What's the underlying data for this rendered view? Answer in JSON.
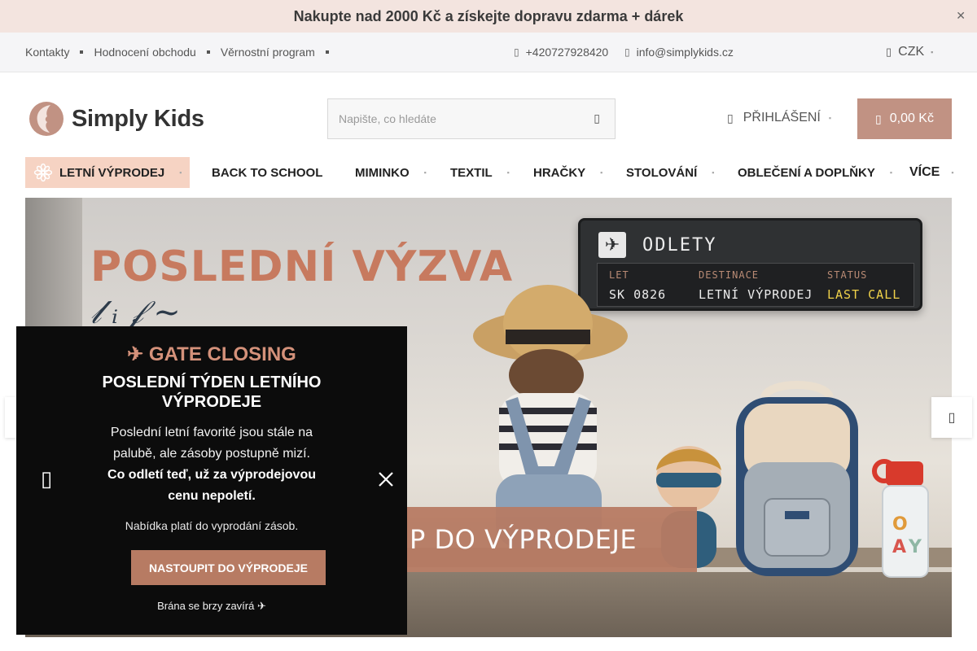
{
  "promo": {
    "text": "Nakupte nad 2000 Kč a získejte  dopravu zdarma +  dárek",
    "close_icon": "close-icon"
  },
  "topbar": {
    "links": [
      "Kontakty",
      "Hodnocení obchodu",
      "Věrnostní program"
    ],
    "phone": "+420727928420",
    "email": "info@simplykids.cz",
    "currency": "CZK"
  },
  "header": {
    "logo_text": "Simply Kids",
    "search_placeholder": "Napište, co hledáte",
    "login_label": "PŘIHLÁŠENÍ",
    "cart_total": "0,00 Kč"
  },
  "nav": {
    "items": [
      "LETNÍ VÝPRODEJ",
      "BACK TO SCHOOL",
      "MIMINKO",
      "TEXTIL",
      "HRAČKY",
      "STOLOVÁNÍ",
      "OBLEČENÍ A DOPLŇKY",
      "VÍCE"
    ]
  },
  "hero": {
    "title": "POSLEDNÍ VÝZVA",
    "board_title": "ODLETY",
    "board_headers": [
      "LET",
      "DESTINACE",
      "STATUS"
    ],
    "board_values": [
      "SK 0826",
      "LETNÍ VÝPRODEJ",
      "LAST CALL"
    ],
    "cta_partial": "P DO VÝPRODEJE"
  },
  "popup": {
    "eyebrow": "✈ GATE CLOSING",
    "title": "POSLEDNÍ TÝDEN LETNÍHO VÝPRODEJE",
    "body": "Poslední letní favorité jsou stále na palubě, ale zásoby postupně mizí.",
    "body_bold": "Co odletí teď, už za výprodejovou cenu nepoletí.",
    "note": "Nabídka platí do vyprodání zásob.",
    "button": "NASTOUPIT DO VÝPRODEJE",
    "footer": "Brána se brzy zavírá ✈"
  },
  "colors": {
    "accent": "#c19283",
    "promo_bg": "#f3e4df",
    "nav_highlight": "#f6d3c3",
    "popup_bg": "#0c0c0c",
    "popup_accent": "#d4917a"
  }
}
